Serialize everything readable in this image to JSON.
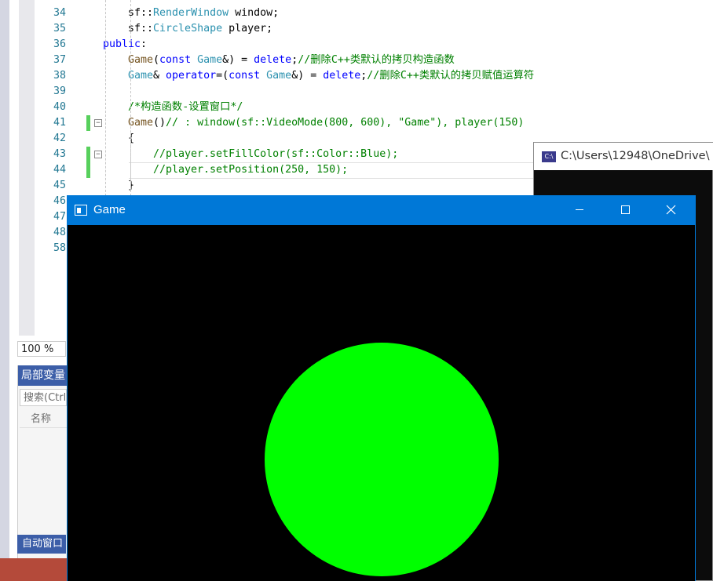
{
  "editor": {
    "lines": [
      {
        "num": "34",
        "segments": [
          [
            "",
            "sf::"
          ],
          [
            "ty",
            "RenderWindow"
          ],
          [
            "",
            " window;"
          ]
        ],
        "indent": 2
      },
      {
        "num": "35",
        "segments": [
          [
            "",
            "sf::"
          ],
          [
            "ty",
            "CircleShape"
          ],
          [
            "",
            " player;"
          ]
        ],
        "indent": 2
      },
      {
        "num": "36",
        "segments": [
          [
            "kw",
            "public"
          ],
          [
            "",
            ":"
          ]
        ],
        "indent": 0
      },
      {
        "num": "37",
        "segments": [
          [
            "fn",
            "Game"
          ],
          [
            "",
            "("
          ],
          [
            "kw",
            "const"
          ],
          [
            "",
            " "
          ],
          [
            "ty",
            "Game"
          ],
          [
            "",
            "&) = "
          ],
          [
            "kw",
            "delete"
          ],
          [
            "",
            ";"
          ],
          [
            "cm",
            "//删除C++类默认的拷贝构造函数"
          ]
        ],
        "indent": 2
      },
      {
        "num": "38",
        "segments": [
          [
            "ty",
            "Game"
          ],
          [
            "",
            "& "
          ],
          [
            "kw",
            "operator"
          ],
          [
            "",
            "=("
          ],
          [
            "kw",
            "const"
          ],
          [
            "",
            " "
          ],
          [
            "ty",
            "Game"
          ],
          [
            "",
            "&) = "
          ],
          [
            "kw",
            "delete"
          ],
          [
            "",
            ";"
          ],
          [
            "cm",
            "//删除C++类默认的拷贝赋值运算符"
          ]
        ],
        "indent": 2
      },
      {
        "num": "39",
        "segments": [],
        "indent": 2
      },
      {
        "num": "40",
        "segments": [
          [
            "cm",
            "/*构造函数-设置窗口*/"
          ]
        ],
        "indent": 2
      },
      {
        "num": "41",
        "segments": [
          [
            "fn",
            "Game"
          ],
          [
            "",
            "()"
          ],
          [
            "cm",
            "// : window(sf::VideoMode(800, 600), \"Game\"), player(150)"
          ]
        ],
        "indent": 2
      },
      {
        "num": "42",
        "segments": [
          [
            "",
            "{"
          ]
        ],
        "indent": 2
      },
      {
        "num": "43",
        "segments": [
          [
            "cm",
            "//player.setFillColor(sf::Color::Blue);"
          ]
        ],
        "indent": 4
      },
      {
        "num": "44",
        "segments": [
          [
            "cm",
            "//player.setPosition(250, 150);"
          ]
        ],
        "indent": 4
      },
      {
        "num": "45",
        "segments": [
          [
            "",
            "}"
          ]
        ],
        "indent": 2
      },
      {
        "num": "46",
        "segments": [],
        "indent": 0
      },
      {
        "num": "47",
        "segments": [],
        "indent": 0
      },
      {
        "num": "48",
        "segments": [],
        "indent": 0
      },
      {
        "num": "58",
        "segments": [],
        "indent": 0
      }
    ],
    "zoom": "100 %"
  },
  "locals": {
    "title": "局部变量",
    "search_placeholder": "搜索(Ctrl",
    "column_name": "名称",
    "auto_window": "自动窗口"
  },
  "console": {
    "title": "C:\\Users\\12948\\OneDrive\\",
    "icon_label": "C:\\"
  },
  "game": {
    "title": "Game",
    "player_color": "#00ff00",
    "background_color": "#000000"
  },
  "colors": {
    "titlebar": "#0078d7",
    "changed_marker": "#57d05c"
  }
}
